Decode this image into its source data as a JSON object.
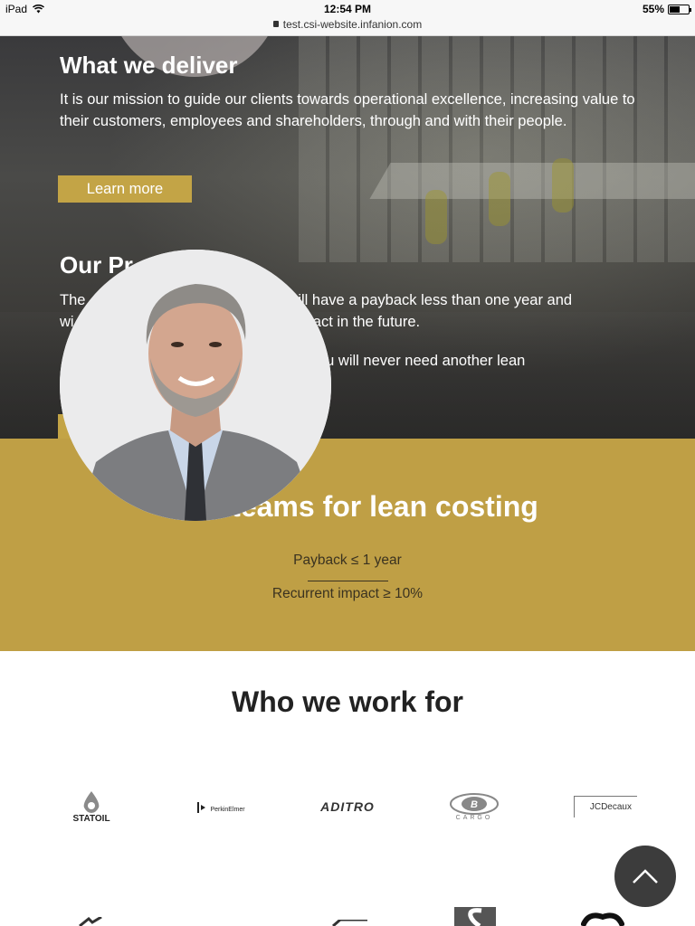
{
  "status_bar": {
    "device": "iPad",
    "time": "12:54 PM",
    "url": "test.csi-website.infanion.com",
    "battery": "55%",
    "battery_level": 0.55
  },
  "hero": {
    "deliver_title": "What we deliver",
    "deliver_text": "It is our mission to guide our clients towards operational excellence, increasing value to their customers, employees and shareholders, through and with their people.",
    "learn_more": "Learn more",
    "program_title_visible": "Our Pr",
    "program_line1_a": "The",
    "program_line1_b": "will have a payback less than one year and",
    "program_line2_a": "wi",
    "program_line2_b": "pact in the future.",
    "program_line3": "ou will never need another lean"
  },
  "gold_band": {
    "heading_visible": "teams for lean costing",
    "payback": "Payback ≤ 1 year",
    "recurrent": "Recurrent impact ≥ 10%"
  },
  "clients": {
    "title": "Who we work for",
    "logos": [
      "STATOIL",
      "PerkinElmer",
      "ADITRO",
      "CARGO",
      "JCDecaux"
    ]
  },
  "colors": {
    "gold": "#bf9f45",
    "button_gold": "#c3a446",
    "dark_overlay": "#3a3a3c"
  },
  "icons": {
    "scroll_top": "chevron-up-icon",
    "wifi": "wifi-icon",
    "lock": "lock-icon",
    "battery": "battery-icon"
  }
}
